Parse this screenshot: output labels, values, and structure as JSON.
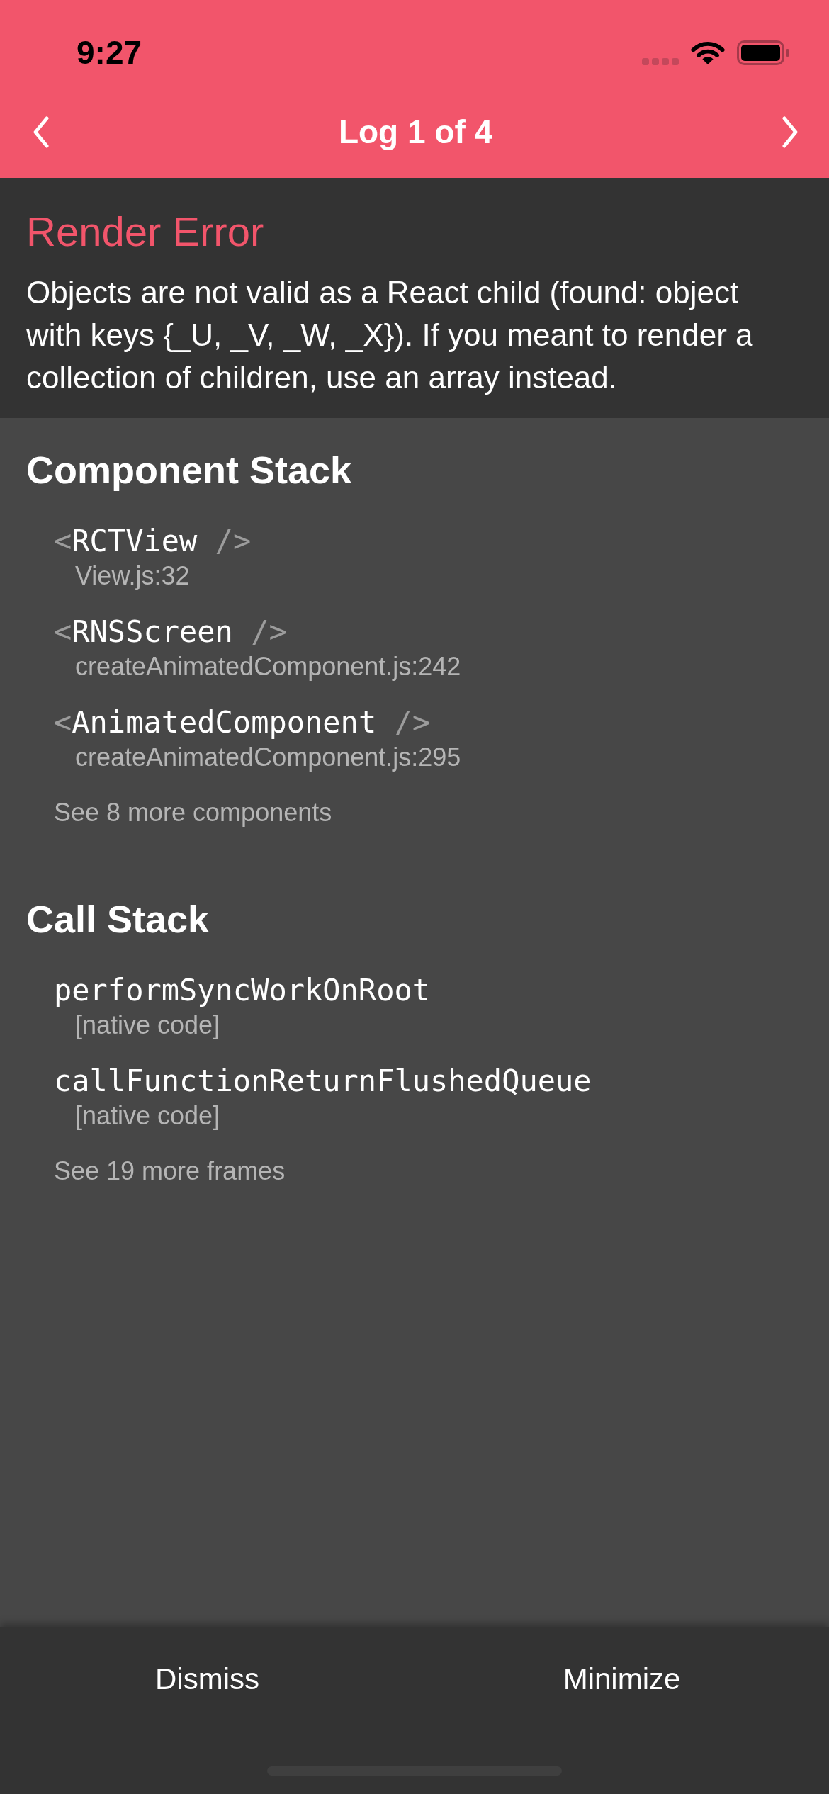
{
  "status_bar": {
    "time": "9:27"
  },
  "header": {
    "title": "Log 1 of 4"
  },
  "error": {
    "title": "Render Error",
    "message": "Objects are not valid as a React child (found: object with keys {_U, _V, _W, _X}). If you meant to render a collection of children, use an array instead."
  },
  "sections": [
    {
      "title": "Component Stack",
      "frames": [
        {
          "open": "<",
          "name": "RCTView",
          "close": "/>",
          "location": "View.js:32"
        },
        {
          "open": "<",
          "name": "RNSScreen",
          "close": "/>",
          "location": "createAnimatedComponent.js:242"
        },
        {
          "open": "<",
          "name": "AnimatedComponent",
          "close": "/>",
          "location": "createAnimatedComponent.js:295"
        }
      ],
      "more": "See 8 more components"
    },
    {
      "title": "Call Stack",
      "frames": [
        {
          "name": "performSyncWorkOnRoot",
          "location": "[native code]"
        },
        {
          "name": "callFunctionReturnFlushedQueue",
          "location": "[native code]"
        }
      ],
      "more": "See 19 more frames"
    }
  ],
  "footer": {
    "buttons": [
      "Dismiss",
      "Minimize"
    ]
  }
}
